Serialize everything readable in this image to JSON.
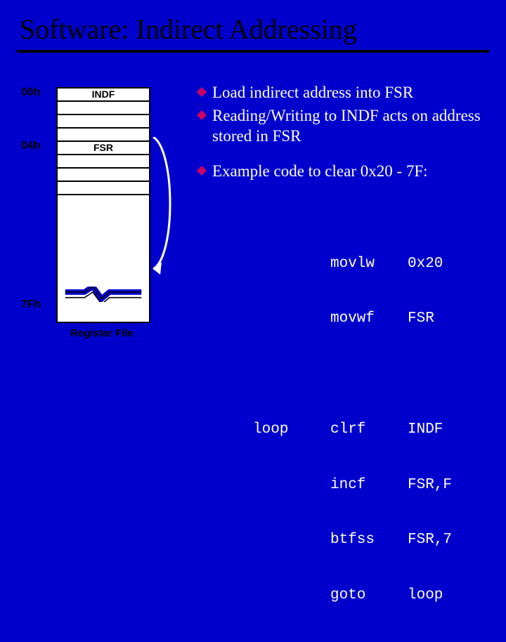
{
  "title": "Software: Indirect Addressing",
  "register_file": {
    "label": "Register File",
    "addresses": {
      "a00": "00h",
      "a04": "04h",
      "a7f": "7Fh"
    },
    "rows": [
      "INDF",
      "",
      "",
      "",
      "FSR",
      "",
      "",
      ""
    ]
  },
  "bullets": [
    "Load indirect address into FSR",
    "Reading/Writing to INDF acts on address stored in FSR",
    "Example code to clear 0x20 - 7F:"
  ],
  "code": [
    {
      "label": "",
      "op": "movlw",
      "arg": "0x20"
    },
    {
      "label": "",
      "op": "movwf",
      "arg": "FSR"
    },
    {
      "label": "",
      "op": "",
      "arg": ""
    },
    {
      "label": "loop",
      "op": "clrf",
      "arg": "INDF"
    },
    {
      "label": "",
      "op": "incf",
      "arg": "FSR,F"
    },
    {
      "label": "",
      "op": "btfss",
      "arg": "FSR,7"
    },
    {
      "label": "",
      "op": "goto",
      "arg": "loop"
    }
  ]
}
